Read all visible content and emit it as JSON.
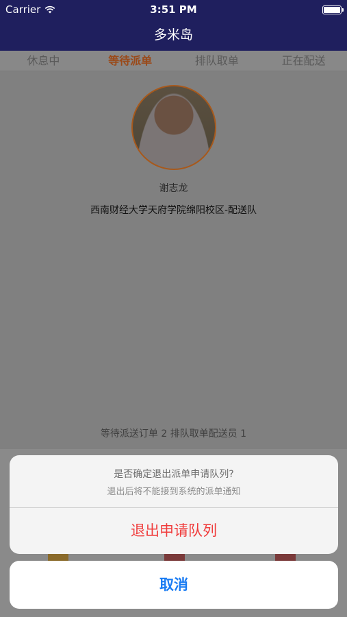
{
  "status_bar": {
    "carrier": "Carrier",
    "time": "3:51 PM"
  },
  "nav": {
    "title": "多米岛"
  },
  "tabs": [
    {
      "label": "休息中",
      "active": false
    },
    {
      "label": "等待派单",
      "active": true
    },
    {
      "label": "排队取单",
      "active": false
    },
    {
      "label": "正在配送",
      "active": false
    }
  ],
  "profile": {
    "name": "谢志龙",
    "organization": "西南财经大学天府学院绵阳校区-配送队"
  },
  "stats": {
    "text": "等待派送订单 2  排队取单配送员 1"
  },
  "action_sheet": {
    "title": "是否确定退出派单申请队列?",
    "message": "退出后将不能接到系统的派单通知",
    "destructive_label": "退出申请队列",
    "cancel_label": "取消"
  },
  "colors": {
    "nav_bg": "#1f1f5e",
    "accent": "#f08020",
    "destructive": "#f03b3b",
    "cancel": "#1a7cf3"
  }
}
